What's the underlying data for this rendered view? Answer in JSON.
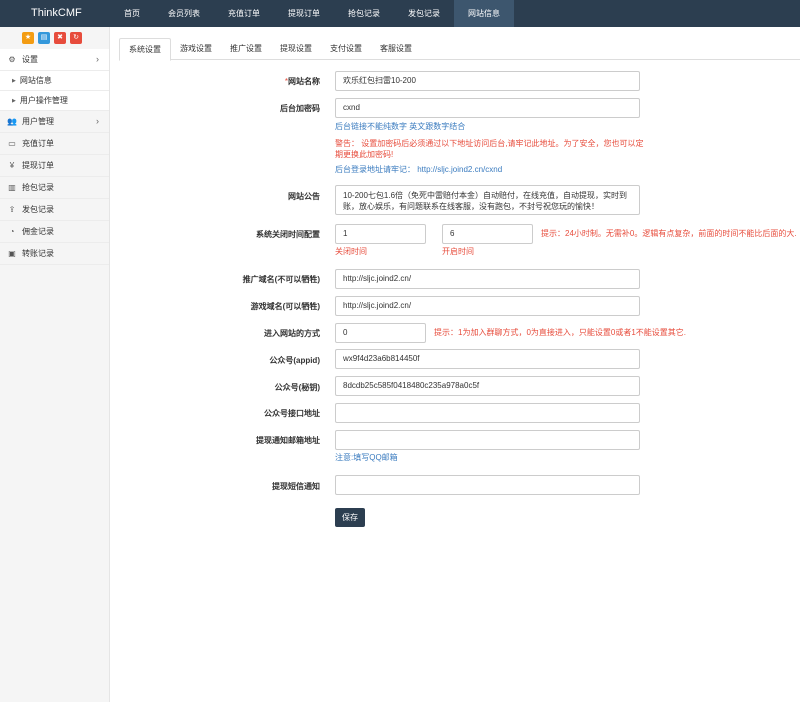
{
  "brand": "ThinkCMF",
  "topnav": [
    "首页",
    "会员列表",
    "充值订单",
    "提现订单",
    "抢包记录",
    "发包记录",
    "网站信息"
  ],
  "colors": {
    "topbar": "#2c3e50",
    "accent_red": "#e74c3c",
    "hint_blue": "#3a7bbf"
  },
  "sidebar": {
    "quick_icons": [
      "star-icon",
      "file-icon",
      "trash-icon",
      "refresh-icon"
    ],
    "settings_label": "设置",
    "settings_sub": [
      "网站信息",
      "用户操作管理"
    ],
    "items": [
      {
        "label": "用户管理",
        "icon": "users-icon",
        "has_children": true
      },
      {
        "label": "充值订单",
        "icon": "card-icon"
      },
      {
        "label": "提现订单",
        "icon": "yen-icon"
      },
      {
        "label": "抢包记录",
        "icon": "bar-chart-icon"
      },
      {
        "label": "发包记录",
        "icon": "upload-icon"
      },
      {
        "label": "佣金记录",
        "icon": "pie-chart-icon"
      },
      {
        "label": "转账记录",
        "icon": "image-icon"
      }
    ]
  },
  "tabs": [
    "系统设置",
    "游戏设置",
    "推广设置",
    "提现设置",
    "支付设置",
    "客服设置"
  ],
  "form": {
    "site_name": {
      "required_mark": "*",
      "label": "网站名称",
      "value": "欢乐红包扫雷10-200"
    },
    "admin_code": {
      "label": "后台加密码",
      "value": "cxnd",
      "hint": "后台链接不能纯数字 英文跟数字结合",
      "warning": "警告： 设置加密码后必须通过以下地址访问后台,请牢记此地址。为了安全，您也可以定期更换此加密码!",
      "login_url": "后台登录地址请牢记： http://sljc.joind2.cn/cxnd"
    },
    "notice": {
      "label": "网站公告",
      "value": "10-200七包1.6倍（免死中雷赔付本金）自动赔付，在线充值，自动提现，实时到账，放心娱乐，有问题联系在线客服，没有跑包，不封号祝您玩的愉快！"
    },
    "close_time": {
      "label": "系统关闭时间配置",
      "close_value": "1",
      "close_caption": "关闭时间",
      "open_value": "6",
      "open_caption": "开启时间",
      "hint": "提示：24小时制。无需补0。逻辑有点复杂，前面的时间不能比后面的大."
    },
    "promo_domain": {
      "label": "推广域名(不可以牺牲)",
      "value": "http://sljc.joind2.cn/"
    },
    "game_domain": {
      "label": "游戏域名(可以牺牲)",
      "value": "http://sljc.joind2.cn/"
    },
    "entry_mode": {
      "label": "进入网站的方式",
      "value": "0",
      "hint": "提示：1为加入群聊方式，0为直接进入，只能设置0或者1不能设置其它."
    },
    "appid": {
      "label": "公众号(appid)",
      "value": "wx9f4d23a6b814450f"
    },
    "secret": {
      "label": "公众号(秘钥)",
      "value": "8dcdb25c585f0418480c235a978a0c5f"
    },
    "api_url": {
      "label": "公众号接口地址",
      "value": ""
    },
    "withdraw_email": {
      "label": "提现通知邮箱地址",
      "value": "",
      "hint": "注意:填写QQ邮箱"
    },
    "withdraw_sms": {
      "label": "提现短信通知",
      "value": ""
    },
    "save_label": "保存"
  }
}
